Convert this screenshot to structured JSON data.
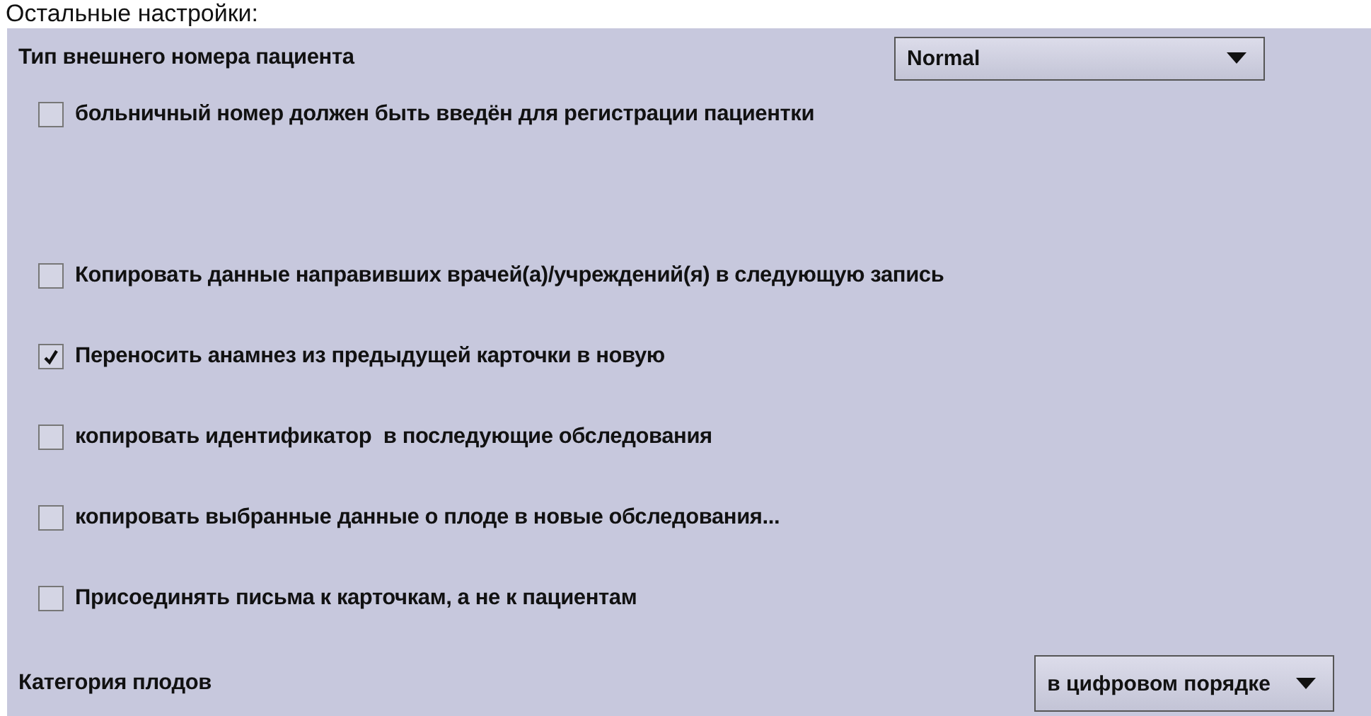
{
  "section_title": "Остальные настройки:",
  "external_number": {
    "label": "Тип внешнего номера пациента",
    "value": "Normal"
  },
  "options": [
    {
      "label": "больничный номер должен быть введён для регистрации пациентки",
      "checked": false
    },
    {
      "label": "Копировать данные направивших врачей(а)/учреждений(я) в следующую запись",
      "checked": false
    },
    {
      "label": "Переносить анамнез из предыдущей карточки в новую",
      "checked": true
    },
    {
      "label": "копировать идентификатор  в последующие обследования",
      "checked": false
    },
    {
      "label": "копировать выбранные данные о плоде в новые обследования...",
      "checked": false
    },
    {
      "label": "Присоединять письма к карточкам, а не к пациентам",
      "checked": false
    }
  ],
  "fetus_category": {
    "label": "Категория плодов",
    "value": "в цифровом порядке"
  }
}
